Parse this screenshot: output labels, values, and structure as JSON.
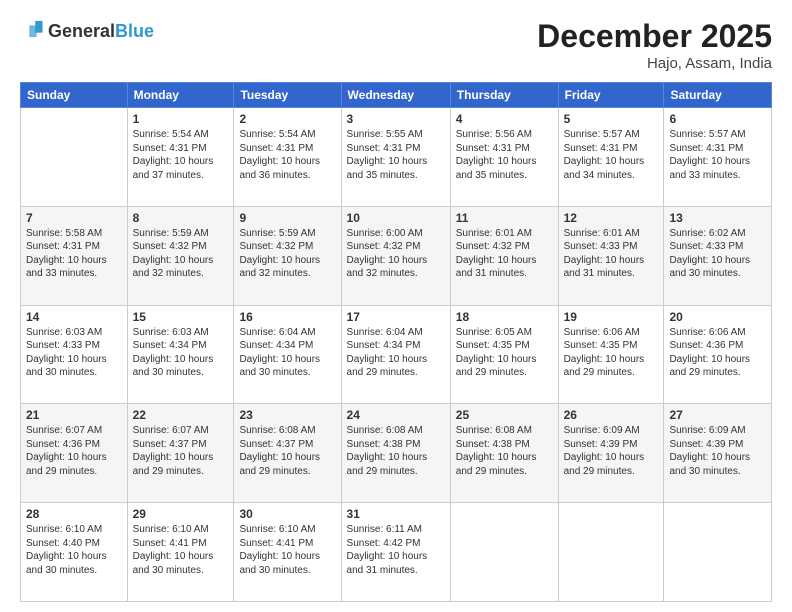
{
  "header": {
    "logo_line1": "General",
    "logo_line2": "Blue",
    "month": "December 2025",
    "location": "Hajo, Assam, India"
  },
  "days_of_week": [
    "Sunday",
    "Monday",
    "Tuesday",
    "Wednesday",
    "Thursday",
    "Friday",
    "Saturday"
  ],
  "weeks": [
    {
      "shade": "white",
      "days": [
        {
          "num": "",
          "info": ""
        },
        {
          "num": "1",
          "info": "Sunrise: 5:54 AM\nSunset: 4:31 PM\nDaylight: 10 hours\nand 37 minutes."
        },
        {
          "num": "2",
          "info": "Sunrise: 5:54 AM\nSunset: 4:31 PM\nDaylight: 10 hours\nand 36 minutes."
        },
        {
          "num": "3",
          "info": "Sunrise: 5:55 AM\nSunset: 4:31 PM\nDaylight: 10 hours\nand 35 minutes."
        },
        {
          "num": "4",
          "info": "Sunrise: 5:56 AM\nSunset: 4:31 PM\nDaylight: 10 hours\nand 35 minutes."
        },
        {
          "num": "5",
          "info": "Sunrise: 5:57 AM\nSunset: 4:31 PM\nDaylight: 10 hours\nand 34 minutes."
        },
        {
          "num": "6",
          "info": "Sunrise: 5:57 AM\nSunset: 4:31 PM\nDaylight: 10 hours\nand 33 minutes."
        }
      ]
    },
    {
      "shade": "shaded",
      "days": [
        {
          "num": "7",
          "info": "Sunrise: 5:58 AM\nSunset: 4:31 PM\nDaylight: 10 hours\nand 33 minutes."
        },
        {
          "num": "8",
          "info": "Sunrise: 5:59 AM\nSunset: 4:32 PM\nDaylight: 10 hours\nand 32 minutes."
        },
        {
          "num": "9",
          "info": "Sunrise: 5:59 AM\nSunset: 4:32 PM\nDaylight: 10 hours\nand 32 minutes."
        },
        {
          "num": "10",
          "info": "Sunrise: 6:00 AM\nSunset: 4:32 PM\nDaylight: 10 hours\nand 32 minutes."
        },
        {
          "num": "11",
          "info": "Sunrise: 6:01 AM\nSunset: 4:32 PM\nDaylight: 10 hours\nand 31 minutes."
        },
        {
          "num": "12",
          "info": "Sunrise: 6:01 AM\nSunset: 4:33 PM\nDaylight: 10 hours\nand 31 minutes."
        },
        {
          "num": "13",
          "info": "Sunrise: 6:02 AM\nSunset: 4:33 PM\nDaylight: 10 hours\nand 30 minutes."
        }
      ]
    },
    {
      "shade": "white",
      "days": [
        {
          "num": "14",
          "info": "Sunrise: 6:03 AM\nSunset: 4:33 PM\nDaylight: 10 hours\nand 30 minutes."
        },
        {
          "num": "15",
          "info": "Sunrise: 6:03 AM\nSunset: 4:34 PM\nDaylight: 10 hours\nand 30 minutes."
        },
        {
          "num": "16",
          "info": "Sunrise: 6:04 AM\nSunset: 4:34 PM\nDaylight: 10 hours\nand 30 minutes."
        },
        {
          "num": "17",
          "info": "Sunrise: 6:04 AM\nSunset: 4:34 PM\nDaylight: 10 hours\nand 29 minutes."
        },
        {
          "num": "18",
          "info": "Sunrise: 6:05 AM\nSunset: 4:35 PM\nDaylight: 10 hours\nand 29 minutes."
        },
        {
          "num": "19",
          "info": "Sunrise: 6:06 AM\nSunset: 4:35 PM\nDaylight: 10 hours\nand 29 minutes."
        },
        {
          "num": "20",
          "info": "Sunrise: 6:06 AM\nSunset: 4:36 PM\nDaylight: 10 hours\nand 29 minutes."
        }
      ]
    },
    {
      "shade": "shaded",
      "days": [
        {
          "num": "21",
          "info": "Sunrise: 6:07 AM\nSunset: 4:36 PM\nDaylight: 10 hours\nand 29 minutes."
        },
        {
          "num": "22",
          "info": "Sunrise: 6:07 AM\nSunset: 4:37 PM\nDaylight: 10 hours\nand 29 minutes."
        },
        {
          "num": "23",
          "info": "Sunrise: 6:08 AM\nSunset: 4:37 PM\nDaylight: 10 hours\nand 29 minutes."
        },
        {
          "num": "24",
          "info": "Sunrise: 6:08 AM\nSunset: 4:38 PM\nDaylight: 10 hours\nand 29 minutes."
        },
        {
          "num": "25",
          "info": "Sunrise: 6:08 AM\nSunset: 4:38 PM\nDaylight: 10 hours\nand 29 minutes."
        },
        {
          "num": "26",
          "info": "Sunrise: 6:09 AM\nSunset: 4:39 PM\nDaylight: 10 hours\nand 29 minutes."
        },
        {
          "num": "27",
          "info": "Sunrise: 6:09 AM\nSunset: 4:39 PM\nDaylight: 10 hours\nand 30 minutes."
        }
      ]
    },
    {
      "shade": "white",
      "days": [
        {
          "num": "28",
          "info": "Sunrise: 6:10 AM\nSunset: 4:40 PM\nDaylight: 10 hours\nand 30 minutes."
        },
        {
          "num": "29",
          "info": "Sunrise: 6:10 AM\nSunset: 4:41 PM\nDaylight: 10 hours\nand 30 minutes."
        },
        {
          "num": "30",
          "info": "Sunrise: 6:10 AM\nSunset: 4:41 PM\nDaylight: 10 hours\nand 30 minutes."
        },
        {
          "num": "31",
          "info": "Sunrise: 6:11 AM\nSunset: 4:42 PM\nDaylight: 10 hours\nand 31 minutes."
        },
        {
          "num": "",
          "info": ""
        },
        {
          "num": "",
          "info": ""
        },
        {
          "num": "",
          "info": ""
        }
      ]
    }
  ]
}
